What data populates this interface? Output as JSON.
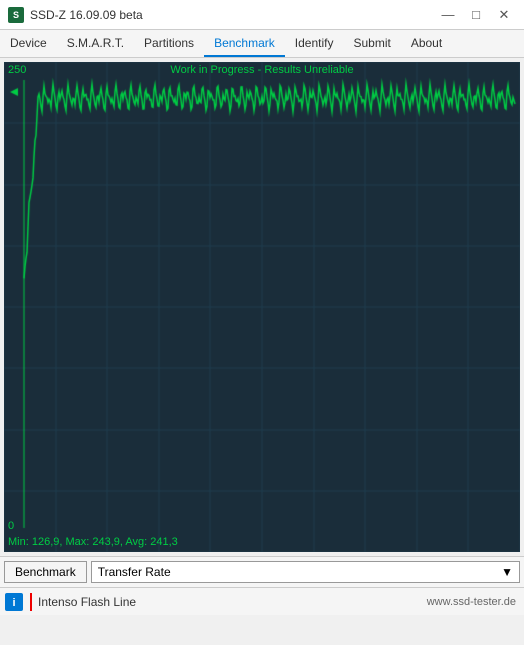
{
  "titlebar": {
    "icon_label": "S",
    "title": "SSD-Z 16.09.09 beta",
    "min_label": "—",
    "max_label": "□",
    "close_label": "✕"
  },
  "menubar": {
    "items": [
      {
        "label": "Device",
        "active": false
      },
      {
        "label": "S.M.A.R.T.",
        "active": false
      },
      {
        "label": "Partitions",
        "active": false
      },
      {
        "label": "Benchmark",
        "active": true
      },
      {
        "label": "Identify",
        "active": false
      },
      {
        "label": "Submit",
        "active": false
      },
      {
        "label": "About",
        "active": false
      }
    ]
  },
  "chart": {
    "y_max": "250",
    "y_min": "0",
    "status_text": "Work in Progress - Results Unreliable",
    "stats_text": "Min: 126,9, Max: 243,9, Avg: 241,3",
    "colors": {
      "background": "#1a2d3a",
      "grid": "#1e3d4f",
      "line": "#00cc44",
      "text": "#00cc44"
    }
  },
  "controls": {
    "benchmark_label": "Benchmark",
    "transfer_rate_label": "Transfer Rate",
    "dropdown_arrow": "▼"
  },
  "statusbar": {
    "device_name": "Intenso Flash Line",
    "url": "www.ssd-tester.de"
  }
}
